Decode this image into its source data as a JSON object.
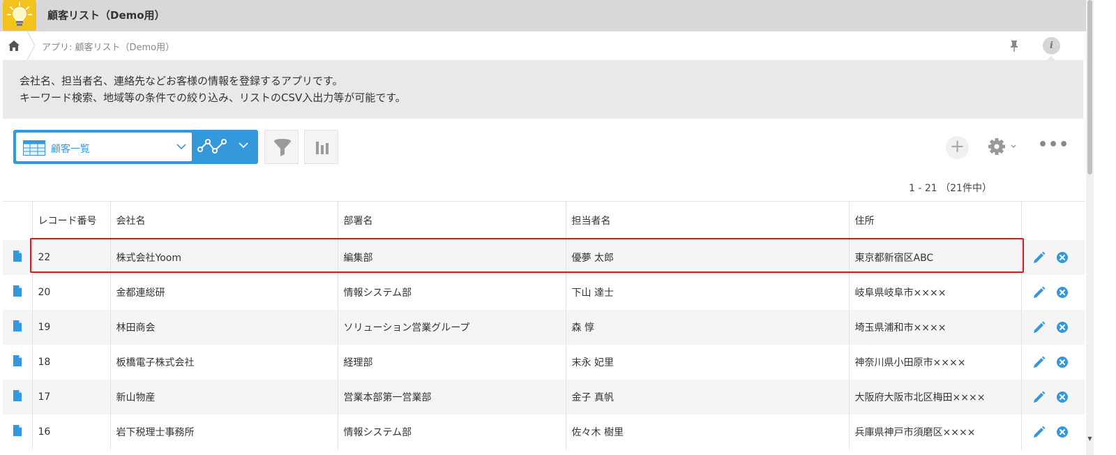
{
  "app": {
    "title": "顧客リスト（Demo用）"
  },
  "breadcrumb": {
    "text": "アプリ: 顧客リスト（Demo用）"
  },
  "description": {
    "line1": "会社名、担当者名、連絡先などお客様の情報を登録するアプリです。",
    "line2": "キーワード検索、地域等の条件での絞り込み、リストのCSV入出力等が可能です。"
  },
  "toolbar": {
    "view_label": "顧客一覧",
    "add_symbol": "+",
    "more_symbol": "•••"
  },
  "pager": {
    "text": "1 - 21 （21件中）"
  },
  "table": {
    "headers": [
      "レコード番号",
      "会社名",
      "部署名",
      "担当者名",
      "住所"
    ],
    "rows": [
      {
        "id": "22",
        "company": "株式会社Yoom",
        "dept": "編集部",
        "person": "優夢 太郎",
        "address": "東京都新宿区ABC"
      },
      {
        "id": "20",
        "company": "金都連総研",
        "dept": "情報システム部",
        "person": "下山 達士",
        "address": "岐阜県岐阜市××××"
      },
      {
        "id": "19",
        "company": "林田商会",
        "dept": "ソリューション営業グループ",
        "person": "森 惇",
        "address": "埼玉県浦和市××××"
      },
      {
        "id": "18",
        "company": "板橋電子株式会社",
        "dept": "経理部",
        "person": "末永 妃里",
        "address": "神奈川県小田原市××××"
      },
      {
        "id": "17",
        "company": "新山物産",
        "dept": "営業本部第一営業部",
        "person": "金子 真帆",
        "address": "大阪府大阪市北区梅田××××"
      },
      {
        "id": "16",
        "company": "岩下税理士事務所",
        "dept": "情報システム部",
        "person": "佐々木 樹里",
        "address": "兵庫県神戸市須磨区××××"
      }
    ]
  },
  "colors": {
    "accent": "#3498db",
    "highlight": "#e0161c",
    "app_icon": "#f4c21d"
  }
}
